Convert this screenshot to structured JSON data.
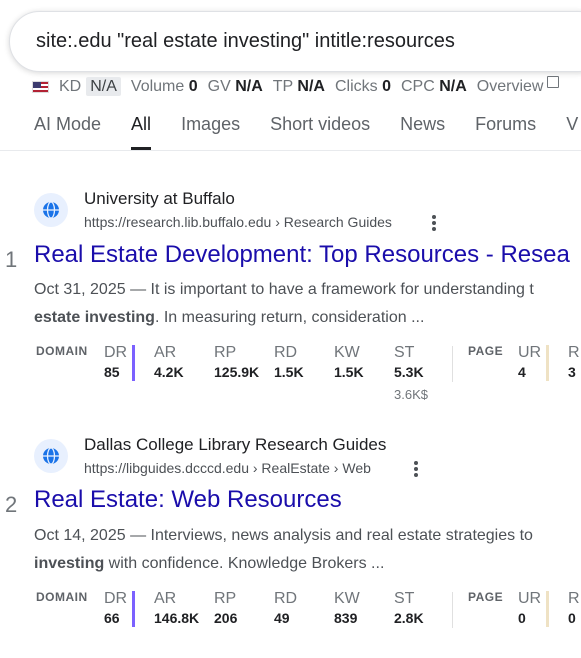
{
  "search": {
    "query": "site:.edu \"real estate investing\" intitle:resources"
  },
  "seo_bar": {
    "kd_label": "KD",
    "kd_value": "N/A",
    "volume_label": "Volume",
    "volume_value": "0",
    "gv_label": "GV",
    "gv_value": "N/A",
    "tp_label": "TP",
    "tp_value": "N/A",
    "clicks_label": "Clicks",
    "clicks_value": "0",
    "cpc_label": "CPC",
    "cpc_value": "N/A",
    "overview_label": "Overview"
  },
  "tabs": [
    "AI Mode",
    "All",
    "Images",
    "Short videos",
    "News",
    "Forums",
    "V"
  ],
  "active_tab": "All",
  "results": [
    {
      "rank": "1",
      "site_name": "University at Buffalo",
      "url": "https://research.lib.buffalo.edu › Research Guides",
      "title": "Real Estate Development: Top Resources - Resea",
      "snippet_line1": "Oct 31, 2025 — It is important to have a framework for understanding t",
      "snippet_bold": "estate investing",
      "snippet_line2_rest": ". In measuring return, consideration ...",
      "metrics": {
        "domain_label": "DOMAIN",
        "page_label": "PAGE",
        "dr_label": "DR",
        "dr": "85",
        "ar_label": "AR",
        "ar": "4.2K",
        "rp_label": "RP",
        "rp": "125.9K",
        "rd_label": "RD",
        "rd": "1.5K",
        "kw_label": "KW",
        "kw": "1.5K",
        "st_label": "ST",
        "st": "5.3K",
        "st_sub": "3.6K$",
        "ur_label": "UR",
        "ur": "4",
        "r_label": "R",
        "r": "3"
      }
    },
    {
      "rank": "2",
      "site_name": "Dallas College Library Research Guides",
      "url": "https://libguides.dcccd.edu › RealEstate › Web",
      "title": "Real Estate: Web Resources",
      "snippet_line1": "Oct 14, 2025 — Interviews, news analysis and real estate strategies to",
      "snippet_bold": "investing",
      "snippet_line2_rest": " with confidence. Knowledge Brokers ...",
      "metrics": {
        "domain_label": "DOMAIN",
        "page_label": "PAGE",
        "dr_label": "DR",
        "dr": "66",
        "ar_label": "AR",
        "ar": "146.8K",
        "rp_label": "RP",
        "rp": "206",
        "rd_label": "RD",
        "rd": "49",
        "kw_label": "KW",
        "kw": "839",
        "st_label": "ST",
        "st": "2.8K",
        "ur_label": "UR",
        "ur": "0",
        "r_label": "R",
        "r": "0"
      }
    }
  ],
  "colors": {
    "link": "#1a0dab",
    "dr_bar": "#7b61ff",
    "ur_bar": "#e6c27a"
  },
  "icons": {
    "favicon": "globe-icon",
    "menu": "more-vert-icon",
    "flag": "us-flag-icon",
    "external": "external-link-icon"
  }
}
